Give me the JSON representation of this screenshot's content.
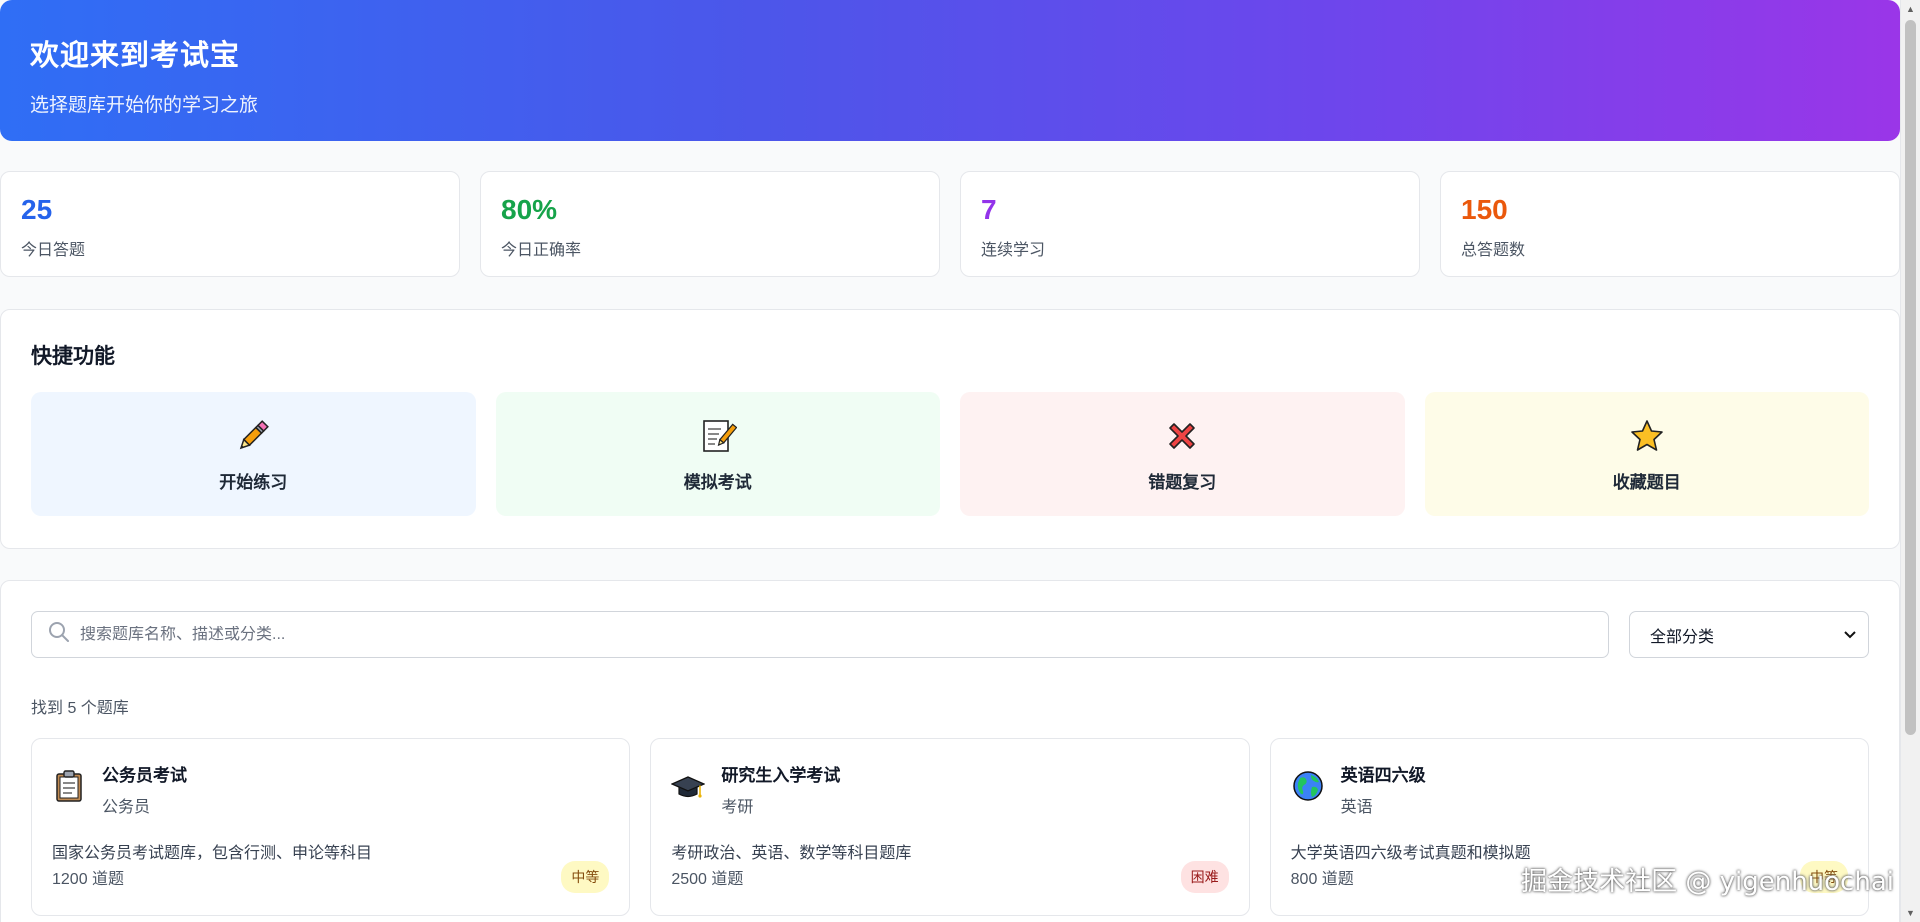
{
  "hero": {
    "title": "欢迎来到考试宝",
    "subtitle": "选择题库开始你的学习之旅"
  },
  "stats": [
    {
      "value": "25",
      "label": "今日答题",
      "color": "#2563eb"
    },
    {
      "value": "80%",
      "label": "今日正确率",
      "color": "#16a34a"
    },
    {
      "value": "7",
      "label": "连续学习",
      "color": "#9333ea"
    },
    {
      "value": "150",
      "label": "总答题数",
      "color": "#ea580c"
    }
  ],
  "quick": {
    "title": "快捷功能",
    "items": [
      {
        "label": "开始练习",
        "icon": "pencil-icon",
        "bg": "#eff6ff"
      },
      {
        "label": "模拟考试",
        "icon": "memo-icon",
        "bg": "#f0fdf4"
      },
      {
        "label": "错题复习",
        "icon": "cross-mark-icon",
        "bg": "#fef2f2"
      },
      {
        "label": "收藏题目",
        "icon": "star-icon",
        "bg": "#fefce8"
      }
    ]
  },
  "bank": {
    "search_placeholder": "搜索题库名称、描述或分类...",
    "category_select": "全部分类",
    "found_text": "找到 5 个题库",
    "cards": [
      {
        "title": "公务员考试",
        "category": "公务员",
        "description": "国家公务员考试题库，包含行测、申论等科目",
        "count": "1200 道题",
        "difficulty": "中等",
        "icon": "clipboard-icon",
        "badge_bg": "#fef9c3",
        "badge_color": "#854d0e"
      },
      {
        "title": "研究生入学考试",
        "category": "考研",
        "description": "考研政治、英语、数学等科目题库",
        "count": "2500 道题",
        "difficulty": "困难",
        "icon": "graduation-cap-icon",
        "badge_bg": "#fee2e2",
        "badge_color": "#991b1b"
      },
      {
        "title": "英语四六级",
        "category": "英语",
        "description": "大学英语四六级考试真题和模拟题",
        "count": "800 道题",
        "difficulty": "中等",
        "icon": "globe-icon",
        "badge_bg": "#fef9c3",
        "badge_color": "#854d0e"
      }
    ]
  },
  "watermark": "掘金技术社区 @ yigenhuochai"
}
